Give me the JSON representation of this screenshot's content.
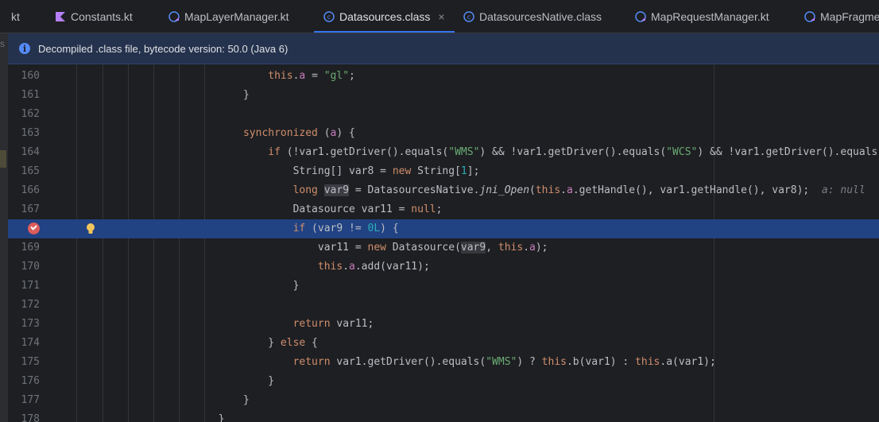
{
  "tabs": [
    {
      "label": "kt",
      "icon": "kotlin-file-icon",
      "active": false
    },
    {
      "label": "Constants.kt",
      "icon": "kotlin-file-icon",
      "active": false
    },
    {
      "label": "MapLayerManager.kt",
      "icon": "kotlin-class-icon",
      "active": false
    },
    {
      "label": "Datasources.class",
      "icon": "class-file-icon",
      "active": true
    },
    {
      "label": "DatasourcesNative.class",
      "icon": "class-file-icon",
      "active": false
    },
    {
      "label": "MapRequestManager.kt",
      "icon": "kotlin-class-icon",
      "active": false
    },
    {
      "label": "MapFragme",
      "icon": "kotlin-class-icon",
      "active": false
    }
  ],
  "active_tab_close": "×",
  "banner": {
    "text": "Decompiled .class file, bytecode version: 50.0 (Java 6)",
    "icon": "info-icon"
  },
  "left_strip_text": "s",
  "editor": {
    "lines": [
      {
        "num": "160"
      },
      {
        "num": "161"
      },
      {
        "num": "162"
      },
      {
        "num": "163"
      },
      {
        "num": "164"
      },
      {
        "num": "165"
      },
      {
        "num": "166"
      },
      {
        "num": "167"
      },
      {
        "num": "168"
      },
      {
        "num": "169"
      },
      {
        "num": "170"
      },
      {
        "num": "171"
      },
      {
        "num": "172"
      },
      {
        "num": "173"
      },
      {
        "num": "174"
      },
      {
        "num": "175"
      },
      {
        "num": "176"
      },
      {
        "num": "177"
      },
      {
        "num": "178"
      }
    ],
    "current_line": "168",
    "breakpoint_icon": "breakpoint-icon",
    "intention_icon": "lightbulb-icon",
    "inlay_hint": "a: null",
    "inlay_hint_cut": "Da"
  },
  "colors": {
    "background": "#1e1f22",
    "keyword": "#cf8e6d",
    "string": "#6aab73",
    "number": "#2aacb8",
    "field": "#c77dbb",
    "current_line": "#214283",
    "accent": "#3574f0",
    "breakpoint": "#db5c5c"
  }
}
